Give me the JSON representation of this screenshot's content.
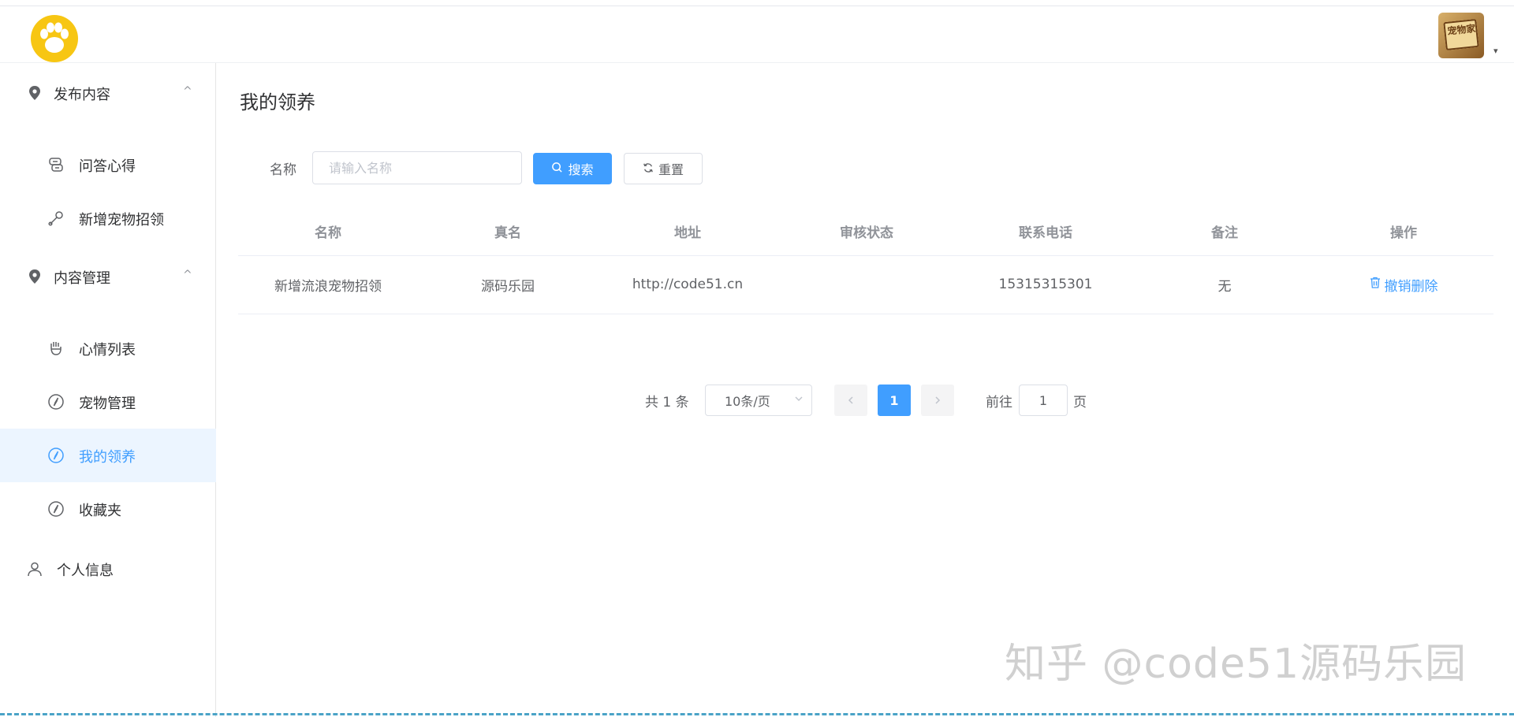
{
  "header": {
    "logo_icon": "paw-icon",
    "avatar_text": "宠物家",
    "avatar_caret": "▾"
  },
  "sidebar": {
    "groups": [
      {
        "label": "发布内容",
        "icon": "location-icon",
        "caret": "^"
      },
      {
        "label": "内容管理",
        "icon": "location-icon",
        "caret": "^"
      },
      {
        "label": "个人信息",
        "icon": "user-icon"
      }
    ],
    "items": [
      {
        "label": "问答心得",
        "icon": "chat-icon"
      },
      {
        "label": "新增宠物招领",
        "icon": "leash-icon"
      },
      {
        "label": "心情列表",
        "icon": "hand-icon"
      },
      {
        "label": "宠物管理",
        "icon": "compass-icon"
      },
      {
        "label": "我的领养",
        "icon": "compass-icon",
        "active": true
      },
      {
        "label": "收藏夹",
        "icon": "compass-icon"
      }
    ]
  },
  "main": {
    "title": "我的领养",
    "search": {
      "label": "名称",
      "placeholder": "请输入名称",
      "search_button": "搜索",
      "reset_button": "重置"
    },
    "table": {
      "columns": [
        "名称",
        "真名",
        "地址",
        "审核状态",
        "联系电话",
        "备注",
        "操作"
      ],
      "rows": [
        {
          "name": "新增流浪宠物招领",
          "real_name": "源码乐园",
          "address": "http://code51.cn",
          "status": "",
          "phone": "15315315301",
          "remark": "无",
          "action": "撤销删除"
        }
      ]
    },
    "pagination": {
      "total": "共 1 条",
      "page_size": "10条/页",
      "current_page": "1",
      "goto_prefix": "前往",
      "goto_value": "1",
      "goto_suffix": "页"
    }
  },
  "watermark": "知乎 @code51源码乐园",
  "colors": {
    "primary": "#409eff",
    "active_bg": "#ecf5ff",
    "logo_yellow": "#f7c613"
  }
}
